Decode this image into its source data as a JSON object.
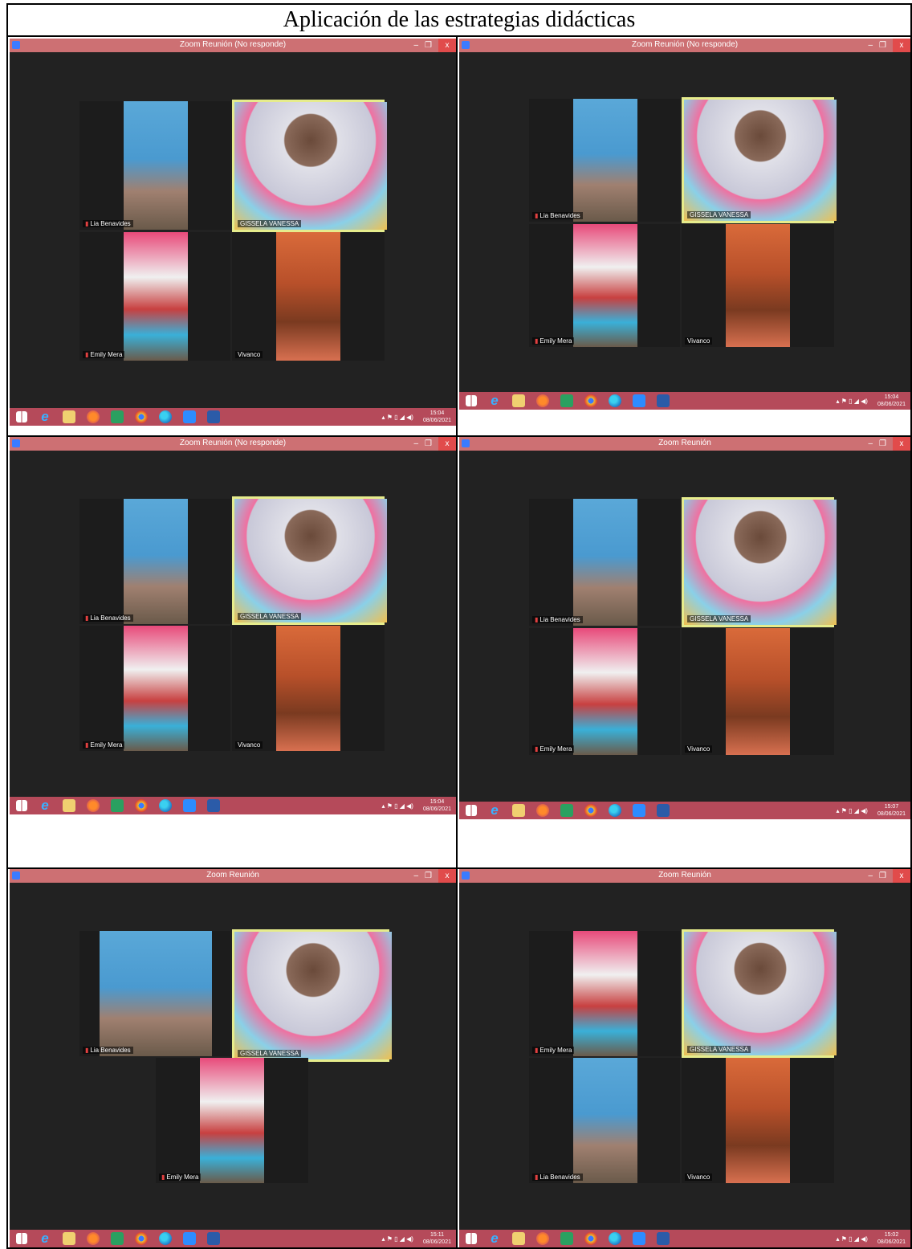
{
  "document": {
    "title": "Aplicación de las estrategias didácticas"
  },
  "screenshots": [
    {
      "window_title": "Zoom Reunión (No responde)",
      "time": "15:04",
      "date": "08/06/2021",
      "tiles": [
        "Lia Benavides",
        "GISSELA VANESSA",
        "Emily Mera",
        "Vivanco"
      ]
    },
    {
      "window_title": "Zoom Reunión (No responde)",
      "time": "15:04",
      "date": "08/06/2021",
      "tiles": [
        "Lia Benavides",
        "GISSELA VANESSA",
        "Emily Mera",
        "Vivanco"
      ]
    },
    {
      "window_title": "Zoom Reunión (No responde)",
      "time": "15:04",
      "date": "08/06/2021",
      "tiles": [
        "Lia Benavides",
        "GISSELA VANESSA",
        "Emily Mera",
        "Vivanco"
      ]
    },
    {
      "window_title": "Zoom Reunión",
      "time": "15:07",
      "date": "08/06/2021",
      "tiles": [
        "Lia Benavides",
        "GISSELA VANESSA",
        "Emily Mera",
        "Vivanco"
      ]
    },
    {
      "window_title": "Zoom Reunión",
      "time": "15:11",
      "date": "08/06/2021",
      "tiles": [
        "Lia Benavides",
        "GISSELA VANESSA",
        "Emily Mera"
      ]
    },
    {
      "window_title": "Zoom Reunión",
      "time": "15:02",
      "date": "08/06/2021",
      "tiles": [
        "Emily Mera",
        "GISSELA VANESSA",
        "Lia Benavides",
        "Vivanco"
      ]
    }
  ],
  "window_controls": {
    "minimize": "–",
    "maximize": "❐",
    "close": "x"
  },
  "colors": {
    "titlebar": "#cd7073",
    "taskbar": "#b54a5a",
    "active_speaker_border": "#e6ec8c"
  },
  "taskbar_icons": [
    "windows-icon",
    "ie-icon",
    "files-icon",
    "firefox-icon",
    "store-icon",
    "chrome-icon",
    "edge-icon",
    "zoom-icon",
    "word-icon"
  ]
}
